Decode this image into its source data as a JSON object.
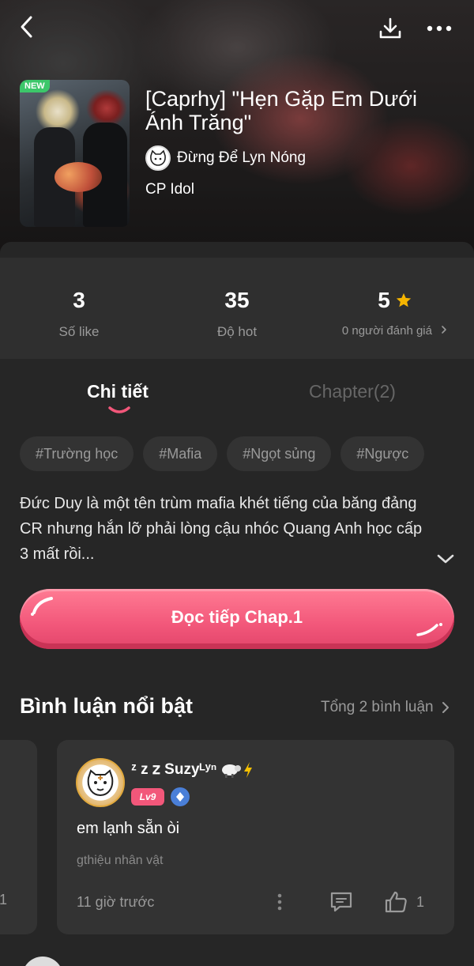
{
  "header": {
    "back_icon": "chevron-left-icon",
    "download_icon": "download-icon",
    "more_icon": "more-horizontal-icon"
  },
  "story": {
    "badge": "NEW",
    "title": "[Caprhy] \"Hẹn Gặp Em Dưới Ánh Trăng\"",
    "author": "Đừng Để Lyn Nóng",
    "category": "CP Idol"
  },
  "stats": {
    "likes_value": "3",
    "likes_label": "Số like",
    "hot_value": "35",
    "hot_label": "Độ hot",
    "rating_value": "5",
    "rating_label": "0 người đánh giá"
  },
  "tabs": {
    "detail": "Chi tiết",
    "chapter": "Chapter(2)"
  },
  "tags": [
    "#Trường học",
    "#Mafia",
    "#Ngọt sủng",
    "#Ngược"
  ],
  "description": "Đức Duy là một tên trùm mafia khét tiếng của băng đảng CR nhưng hắn lỡ phải lòng cậu nhóc Quang Anh học cấp 3 mất rồi...",
  "read_button": "Đọc tiếp Chap.1",
  "comments": {
    "title": "Bình luận nổi bật",
    "total": "Tổng 2 bình luận",
    "prev_card_count": "1",
    "item": {
      "user": "ᶻ z 𝗓 Suzyᴸʸⁿ",
      "level": "Lv9",
      "text": "em lạnh sẵn òi",
      "ref": "gthiệu nhân vật",
      "time": "11 giờ trước",
      "likes": "1"
    }
  },
  "colors": {
    "accent": "#f2577a",
    "background": "#262626",
    "card": "#333333",
    "star": "#f5b400",
    "new_badge": "#3cc76a"
  }
}
